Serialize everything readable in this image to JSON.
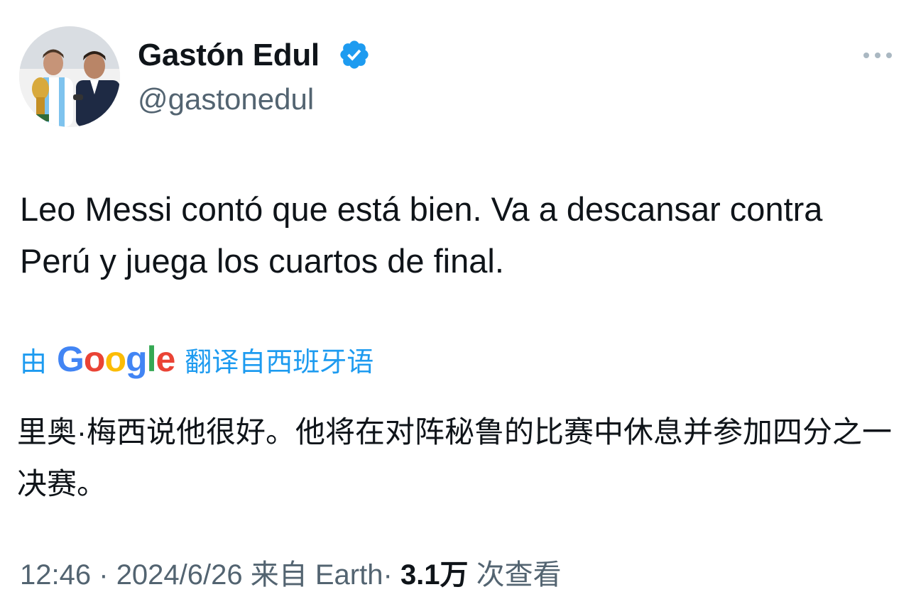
{
  "author": {
    "display_name": "Gastón Edul",
    "handle": "@gastonedul",
    "verified": true
  },
  "tweet": {
    "text": "Leo Messi contó que está bien. Va a descansar contra Perú y juega los cuartos de final."
  },
  "translation": {
    "prefix": "由",
    "provider": "Google",
    "suffix": "翻译自西班牙语",
    "text": "里奥·梅西说他很好。他将在对阵秘鲁的比赛中休息并参加四分之一决赛。"
  },
  "meta": {
    "time": "12:46",
    "separator": "·",
    "date": "2024/6/26",
    "source": "来自 Earth",
    "views_count": "3.1万",
    "views_label": "次查看"
  },
  "icons": {
    "verified": "verified-badge-icon",
    "more": "more-dots-icon"
  },
  "colors": {
    "accent": "#1d9bf0",
    "text_primary": "#0f1419",
    "text_secondary": "#536471",
    "google_blue": "#4285f4",
    "google_red": "#ea4335",
    "google_yellow": "#fbbc05",
    "google_green": "#34a853"
  }
}
